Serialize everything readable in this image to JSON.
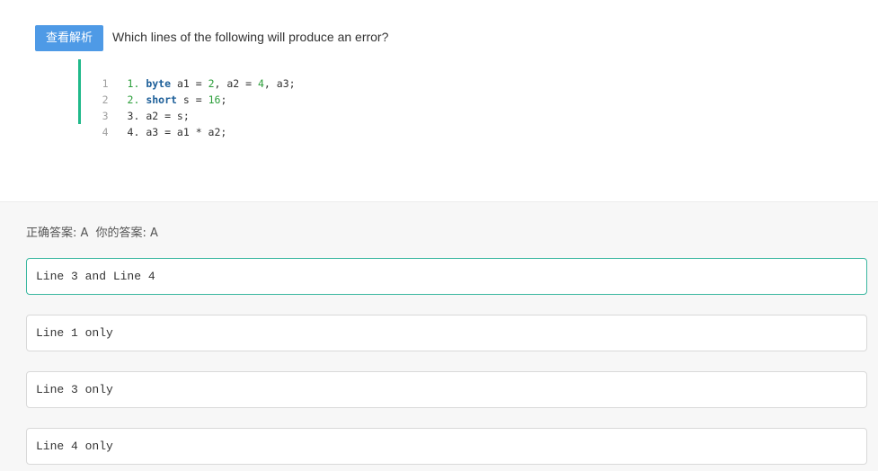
{
  "question": {
    "view_button_label": "查看解析",
    "text": "Which lines of the following will produce an error?",
    "code_lines": [
      {
        "line_no": "1",
        "parts": [
          {
            "t": "1. ",
            "c": "num-green"
          },
          {
            "t": "byte",
            "c": "kw"
          },
          {
            "t": " a1 = ",
            "c": ""
          },
          {
            "t": "2",
            "c": "lit"
          },
          {
            "t": ", a2 = ",
            "c": ""
          },
          {
            "t": "4",
            "c": "lit"
          },
          {
            "t": ", a3;",
            "c": ""
          }
        ]
      },
      {
        "line_no": "2",
        "parts": [
          {
            "t": "2. ",
            "c": "num-green"
          },
          {
            "t": "short",
            "c": "kw"
          },
          {
            "t": " s = ",
            "c": ""
          },
          {
            "t": "16",
            "c": "lit"
          },
          {
            "t": ";",
            "c": ""
          }
        ]
      },
      {
        "line_no": "3",
        "parts": [
          {
            "t": "3. a2 = s;",
            "c": ""
          }
        ]
      },
      {
        "line_no": "4",
        "parts": [
          {
            "t": "4. a3 = a1 * a2;",
            "c": ""
          }
        ]
      }
    ]
  },
  "answer": {
    "correct_label": "正确答案: A",
    "yours_label": "你的答案: A"
  },
  "options": [
    {
      "text": "Line 3 and Line 4",
      "selected": true
    },
    {
      "text": "Line 1 only",
      "selected": false
    },
    {
      "text": "Line 3 only",
      "selected": false
    },
    {
      "text": "Line 4 only",
      "selected": false
    }
  ],
  "colors": {
    "button_bg": "#4e9ae6",
    "code_bar": "#20b98a",
    "selected_border": "#3ab7a0",
    "answer_bg": "#f7f7f7"
  }
}
